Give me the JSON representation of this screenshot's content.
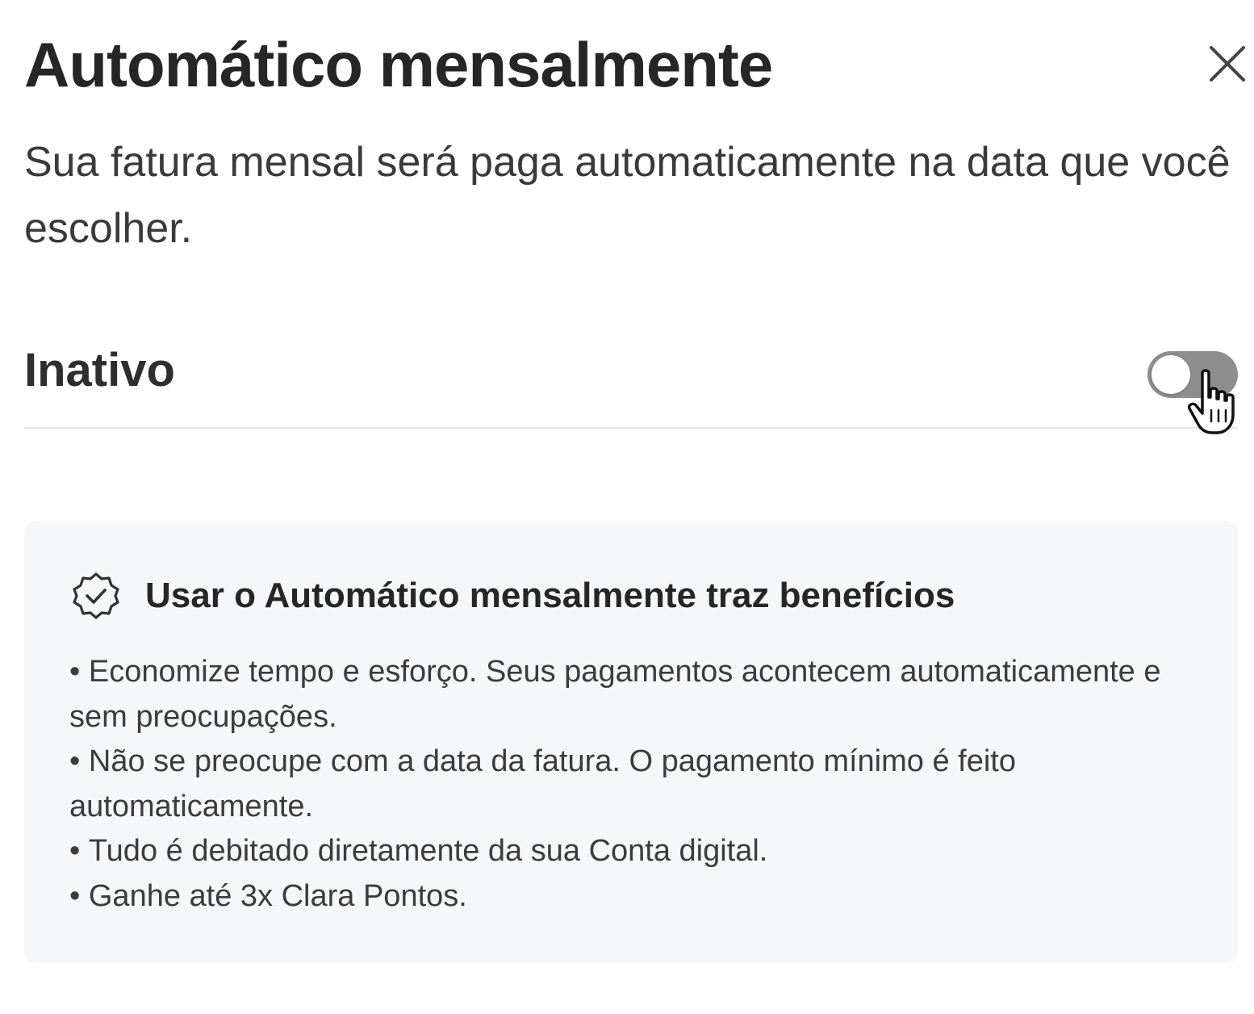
{
  "dialog": {
    "title": "Automático mensalmente",
    "close_icon": "close-icon",
    "subtitle": "Sua fatura mensal será paga automaticamente na data que você escolher."
  },
  "status": {
    "label": "Inativo",
    "toggle_on": false,
    "toggle_color": "#8e8e8e"
  },
  "benefits": {
    "icon": "verified-badge-icon",
    "title": "Usar o Automático mensalmente traz benefícios",
    "items": [
      "Economize tempo e esforço. Seus pagamentos acontecem automaticamente e sem preocupações.",
      "Não se preocupe com a data da fatura. O pagamento mínimo é feito automaticamente.",
      "Tudo é debitado diretamente da sua Conta digital.",
      "Ganhe até 3x Clara Pontos."
    ]
  }
}
